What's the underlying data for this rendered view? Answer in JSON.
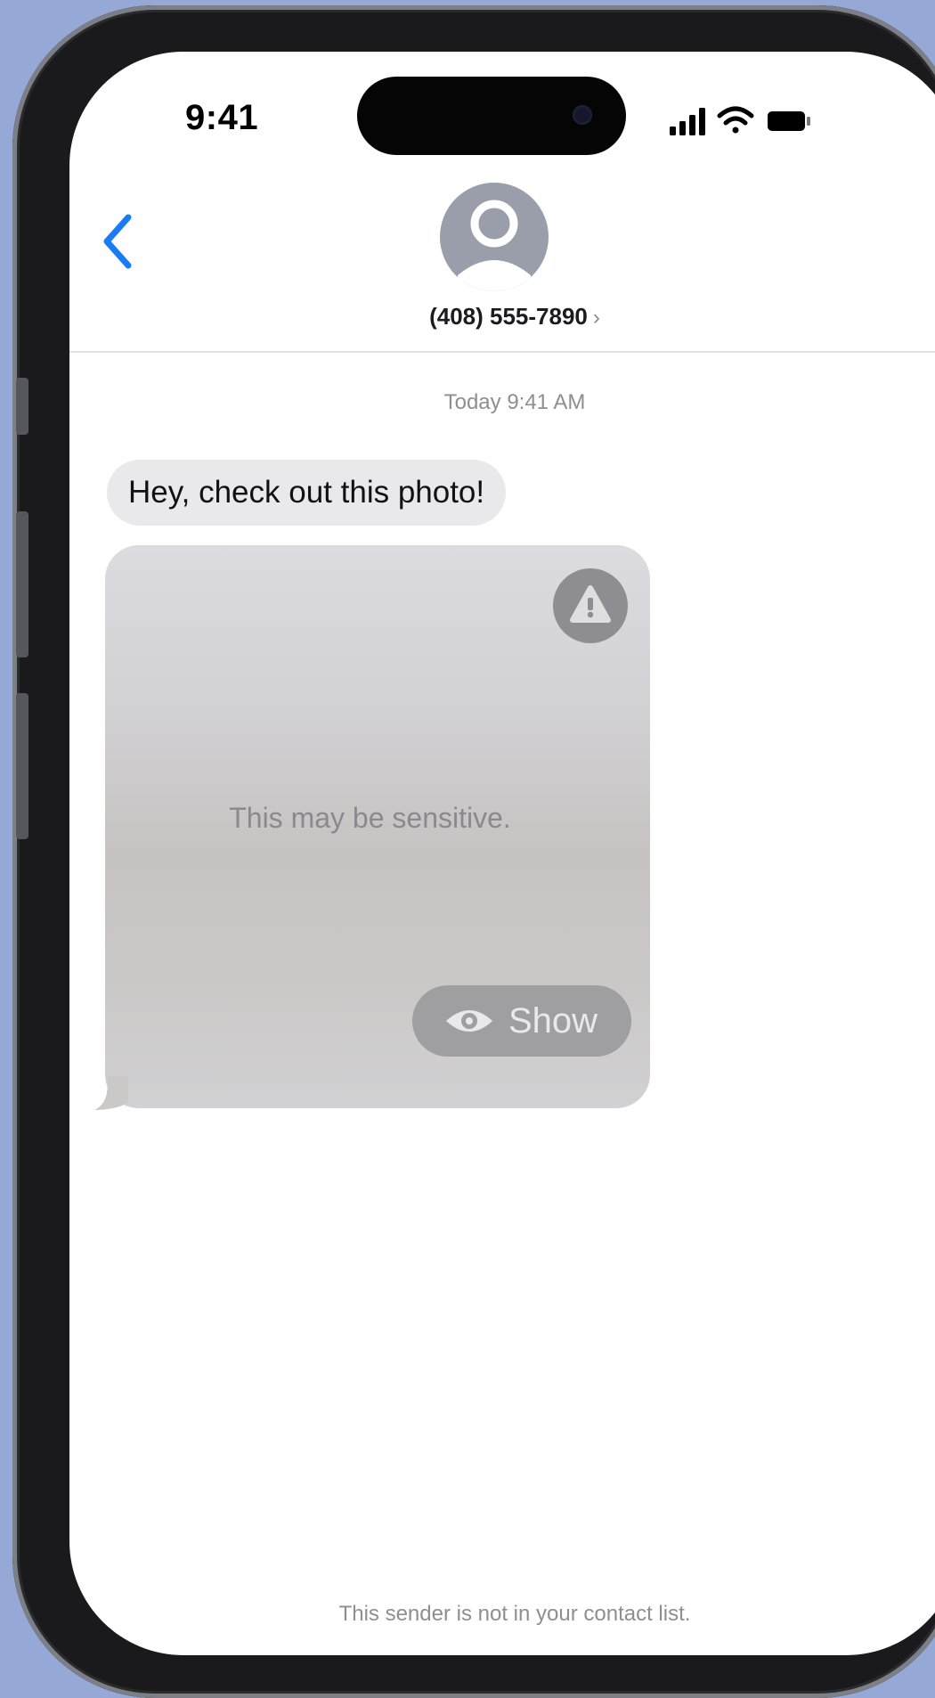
{
  "status_bar": {
    "time": "9:41",
    "icons": [
      "cellular-signal-icon",
      "wifi-icon",
      "battery-icon"
    ]
  },
  "header": {
    "back_icon": "chevron-left-icon",
    "avatar_icon": "person-icon",
    "contact_number": "(408) 555-7890",
    "contact_chevron": "›"
  },
  "conversation": {
    "timestamp": "Today 9:41 AM",
    "messages": [
      {
        "type": "text",
        "text": "Hey, check out this photo!"
      },
      {
        "type": "sensitive-photo",
        "warning_icon": "exclamation-triangle-icon",
        "notice": "This may be sensitive.",
        "show_button": {
          "icon": "eye-icon",
          "label": "Show"
        }
      }
    ],
    "footer_note": "This sender is not in your contact list."
  },
  "colors": {
    "background": "#95a8d6",
    "accent_blue": "#1a7cf5",
    "incoming_bubble": "#e9e9eb",
    "avatar": "#9a9daa",
    "secondary_text": "#8e8e93"
  }
}
